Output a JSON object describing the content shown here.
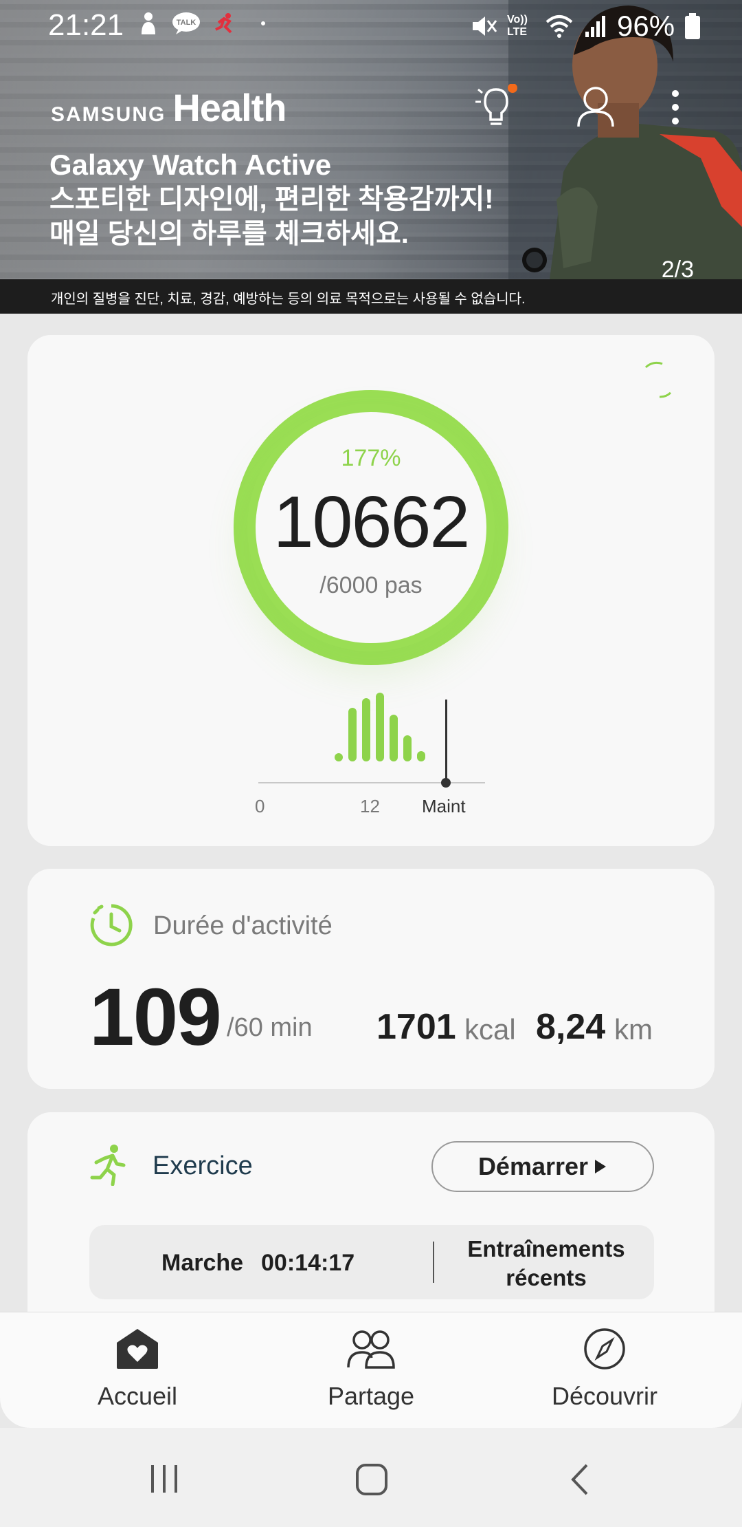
{
  "status_bar": {
    "time": "21:21",
    "battery": "96%",
    "network_label": "Vo)) LTE"
  },
  "hero": {
    "brand_small": "SAMSUNG",
    "brand_large": "Health",
    "title": "Galaxy Watch Active",
    "line1": "스포티한 디자인에, 편리한 착용감까지!",
    "line2": "매일 당신의 하루를 체크하세요.",
    "pager": "2/3",
    "disclaimer": "개인의 질병을 진단, 치료, 경감, 예방하는 등의 의료 목적으로는 사용될 수 없습니다."
  },
  "steps": {
    "percent": "177%",
    "value": "10662",
    "goal": "/6000 pas",
    "progress_fraction": 1.0,
    "hourly_bars_relative": [
      0.12,
      0.78,
      0.92,
      1.0,
      0.68,
      0.38,
      0.15
    ],
    "ticks": [
      "0",
      "12",
      "Maint"
    ]
  },
  "activity": {
    "title": "Durée d'activité",
    "minutes": "109",
    "goal": "/60 min",
    "kcal": "1701",
    "kcal_unit": "kcal",
    "distance": "8,24",
    "distance_unit": "km"
  },
  "exercise": {
    "title": "Exercice",
    "start_label": "Démarrer",
    "recent_type": "Marche",
    "recent_time": "00:14:17",
    "recent_link": "Entraînements récents"
  },
  "bottom_nav": {
    "items": [
      {
        "label": "Accueil",
        "icon": "home-icon"
      },
      {
        "label": "Partage",
        "icon": "people-icon"
      },
      {
        "label": "Découvrir",
        "icon": "compass-icon"
      }
    ]
  },
  "colors": {
    "accent_green": "#8ed34b",
    "text_dark": "#1f1f1f",
    "notification_dot": "#f26a1b"
  }
}
